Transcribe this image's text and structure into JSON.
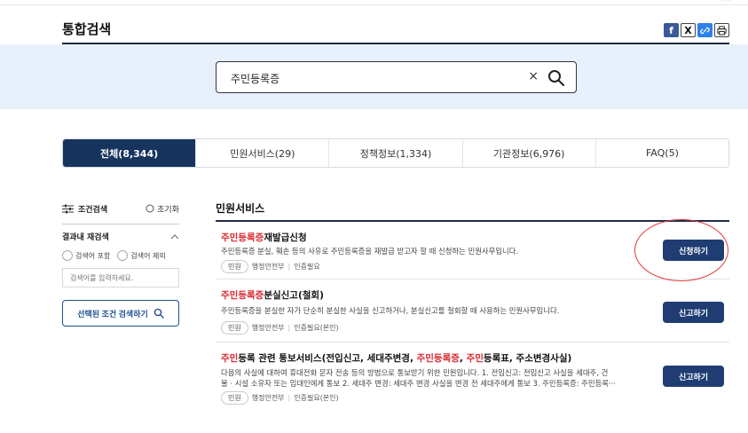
{
  "header": {
    "title": "통합검색",
    "share_icons": [
      "facebook-icon",
      "x-icon",
      "link-icon",
      "print-icon"
    ]
  },
  "search": {
    "value": "주민등록증",
    "clear_glyph": "×"
  },
  "tabs": [
    {
      "label": "전체(8,344)",
      "active": true
    },
    {
      "label": "민원서비스(29)",
      "active": false
    },
    {
      "label": "정책정보(1,334)",
      "active": false
    },
    {
      "label": "기관정보(6,976)",
      "active": false
    },
    {
      "label": "FAQ(5)",
      "active": false
    }
  ],
  "sidebar": {
    "condition_label": "조건검색",
    "reset_label": "초기화",
    "refine_label": "결과내 재검색",
    "include_label": "검색어 포함",
    "exclude_label": "검색어 제외",
    "input_placeholder": "검색어를 입력하세요.",
    "apply_button": "선택된 조건 검색하기"
  },
  "main": {
    "section_title": "민원서비스",
    "results": [
      {
        "title_highlight": "주민등록증",
        "title_rest": "재발급신청",
        "description": "주민등록증 분실, 훼손 등의 사유로 주민등록증을 재발급 받고자 할 때 신청하는 민원사무입니다.",
        "tag": "민원",
        "agency": "행정안전부",
        "auth": "인증필요",
        "button": "신청하기"
      },
      {
        "title_highlight": "주민등록증",
        "title_rest": "분실신고(철회)",
        "description": "주민등록증을 분실한 자가 단순히 분실한 사실을 신고하거나, 분실신고를 철회할 때 사용하는 민원사무입니다.",
        "tag": "민원",
        "agency": "행정안전부",
        "auth": "인증필요(본인)",
        "button": "신고하기"
      },
      {
        "title_parts": [
          {
            "text": "주민",
            "hl": true
          },
          {
            "text": "등록 관련 통보서비스(전입신고, 세대주변경, ",
            "hl": false
          },
          {
            "text": "주민등록증",
            "hl": true
          },
          {
            "text": ", ",
            "hl": false
          },
          {
            "text": "주민",
            "hl": true
          },
          {
            "text": "등록표, 주소변경사실)",
            "hl": false
          }
        ],
        "description_line1": "다음의 사실에 대하여 휴대전화 문자 전송 등의 방법으로 통보받기 위한 민원입니다. 1. 전입신고: 전입신고 사실을 세대주, 건",
        "description_line2": "물 · 시설 소유자 또는 임대인에게 통보 2. 세대주 변경: 세대주 변경 사실을 변경 전 세대주에게 통보 3. 주민등록증: 주민등록···",
        "tag": "민원",
        "agency": "행정안전부",
        "auth": "인증필요(본인)",
        "button": "신고하기"
      }
    ]
  },
  "colors": {
    "accent_navy": "#16345e",
    "highlight_red": "#d9282f",
    "search_band": "#e8f1fb"
  }
}
